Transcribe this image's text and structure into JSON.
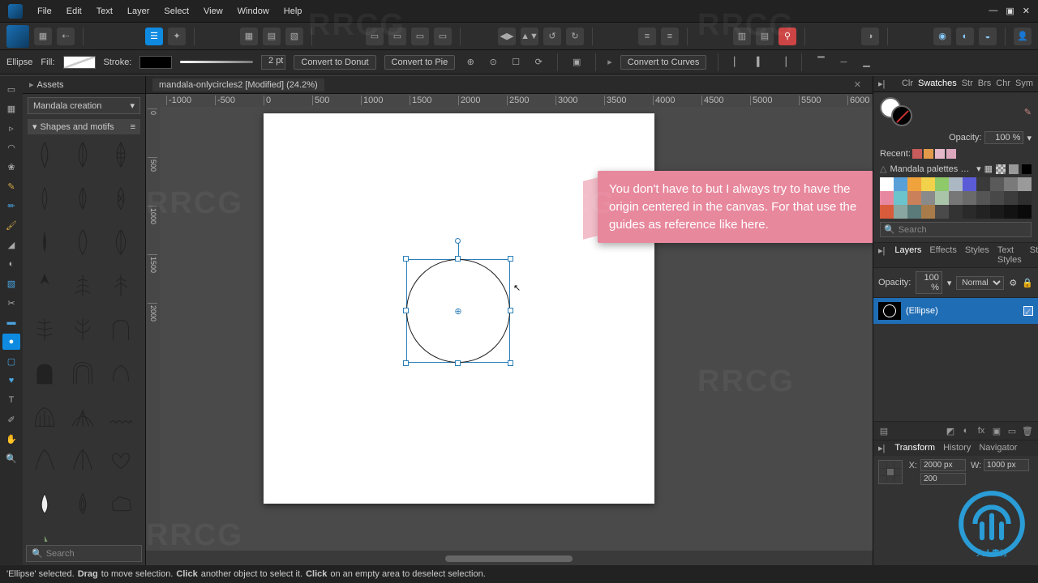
{
  "menu": {
    "items": [
      "File",
      "Edit",
      "Text",
      "Layer",
      "Select",
      "View",
      "Window",
      "Help"
    ]
  },
  "context": {
    "tool": "Ellipse",
    "fill_label": "Fill:",
    "stroke_label": "Stroke:",
    "pt_value": "2 pt",
    "btns": {
      "donut": "Convert to Donut",
      "pie": "Convert to Pie",
      "curves": "Convert to Curves"
    }
  },
  "doc": {
    "title": "mandala-onlycircles2 [Modified] (24.2%)"
  },
  "ruler_h": [
    "-1000",
    "-500",
    "0",
    "500",
    "1000",
    "1500",
    "2000",
    "2500",
    "3000",
    "3500",
    "4000",
    "4500",
    "5000",
    "5500",
    "6000"
  ],
  "ruler_v": [
    "0",
    "500",
    "1000",
    "1500",
    "2000"
  ],
  "assets": {
    "tab": "Assets",
    "dropdown": "Mandala creation",
    "section": "Shapes and motifs",
    "search": "Search"
  },
  "right": {
    "tabs": [
      "Clr",
      "Swatches",
      "Str",
      "Brs",
      "Chr",
      "Sym"
    ],
    "opacity_label": "Opacity:",
    "opacity_value": "100 %",
    "recent_label": "Recent:",
    "recent": [
      "#c85b5b",
      "#e19a4a",
      "#e4b8c9",
      "#dca7bd"
    ],
    "palette_name": "Mandala palettes by P",
    "palette": [
      "#ffffff",
      "#5aa0d8",
      "#f0a23c",
      "#f2d24a",
      "#8ec96a",
      "#abb8c3",
      "#5b5bd8",
      "#3a3a3a",
      "#5a5a5a",
      "#7a7a7a",
      "#9a9a9a",
      "#e888a0",
      "#6bc3cc",
      "#c9805b",
      "#8a8a8a",
      "#aac4aa",
      "#777777",
      "#6a6a6a",
      "#555555",
      "#484848",
      "#3c3c3c",
      "#2e2e2e",
      "#d85b3c",
      "#8aa6a0",
      "#5b7a7a",
      "#a87c4a",
      "#4a4a4a",
      "#333333",
      "#2a2a2a",
      "#222222",
      "#1a1a1a",
      "#121212",
      "#0a0a0a"
    ],
    "pal_search": "Search",
    "layer_tabs": [
      "Layers",
      "Effects",
      "Styles",
      "Text Styles",
      "Stock"
    ],
    "layer_opacity": "100 %",
    "blend": "Normal",
    "layer_name": "(Ellipse)",
    "tf_tabs": [
      "Transform",
      "History",
      "Navigator"
    ],
    "tf": {
      "x_label": "X:",
      "x": "2000 px",
      "w_label": "W:",
      "w": "1000 px",
      "y_label": " ",
      "y": "200"
    }
  },
  "tooltip": "You don't have to but I always try to have the origin centered in the canvas. For that use the guides as reference like here.",
  "status": {
    "sel": "'Ellipse' selected.",
    "drag_b": "Drag",
    "drag_t": " to move selection. ",
    "click_b": "Click",
    "click_t": " another object to select it. ",
    "click2_b": "Click",
    "click2_t": " on an empty area to deselect selection."
  }
}
